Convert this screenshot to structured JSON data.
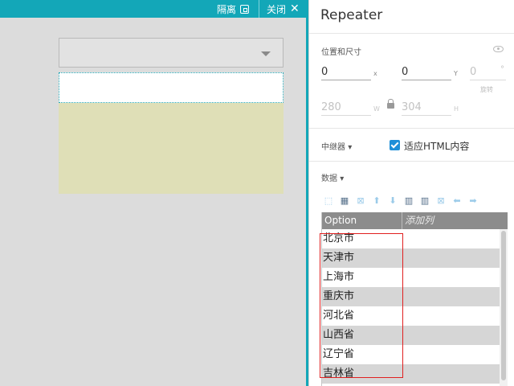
{
  "canvas": {
    "isolate_label": "隔离",
    "close_label": "关闭",
    "close_glyph": "✕"
  },
  "inspector": {
    "title": "Repeater",
    "position_section": "位置和尺寸",
    "x_value": "0",
    "x_axis": "x",
    "y_value": "0",
    "y_axis": "Y",
    "rotation_value": "0",
    "rotation_unit": "°",
    "rotation_label": "旋转",
    "width_value": "280",
    "width_axis": "W",
    "height_value": "304",
    "height_axis": "H",
    "repeater_section": "中继器",
    "fit_html_checked": true,
    "fit_html_label": "适应HTML内容",
    "data_section": "数据",
    "dropdown_marker": "▾"
  },
  "toolbar_icons": [
    {
      "name": "insert-row-icon",
      "glyph": "⬚"
    },
    {
      "name": "add-rows-icon",
      "glyph": "▦"
    },
    {
      "name": "delete-row-icon",
      "glyph": "⊠"
    },
    {
      "name": "move-up-icon",
      "glyph": "⬆"
    },
    {
      "name": "move-down-icon",
      "glyph": "⬇"
    },
    {
      "name": "insert-column-left-icon",
      "glyph": "▥"
    },
    {
      "name": "insert-column-right-icon",
      "glyph": "▥"
    },
    {
      "name": "delete-column-icon",
      "glyph": "⊠"
    },
    {
      "name": "move-left-icon",
      "glyph": "⬅"
    },
    {
      "name": "move-right-icon",
      "glyph": "➡"
    }
  ],
  "grid": {
    "columns": [
      "Option",
      "添加列"
    ],
    "rows": [
      "北京市",
      "天津市",
      "上海市",
      "重庆市",
      "河北省",
      "山西省",
      "辽宁省",
      "吉林省"
    ]
  }
}
